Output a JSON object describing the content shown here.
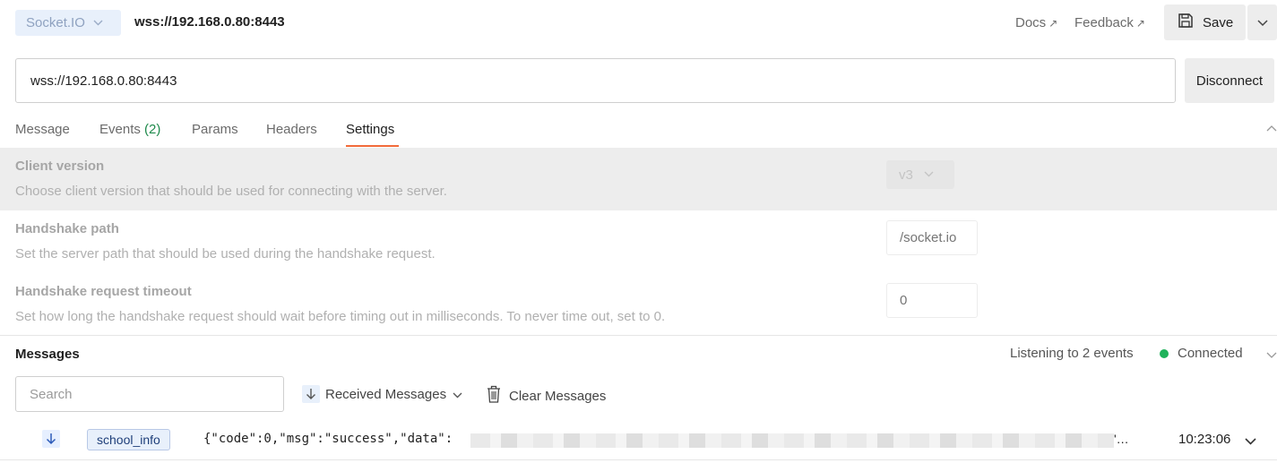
{
  "topbar": {
    "protocol": "Socket.IO",
    "url": "wss://192.168.0.80:8443",
    "docs_label": "Docs",
    "feedback_label": "Feedback",
    "save_label": "Save"
  },
  "connection": {
    "url_value": "wss://192.168.0.80:8443",
    "disconnect_label": "Disconnect"
  },
  "tabs": [
    {
      "label": "Message"
    },
    {
      "label": "Events",
      "count": "(2)"
    },
    {
      "label": "Params"
    },
    {
      "label": "Headers"
    },
    {
      "label": "Settings",
      "active": true
    }
  ],
  "settings": [
    {
      "title": "Client version",
      "description": "Choose client version that should be used for connecting with the server.",
      "value": "v3"
    },
    {
      "title": "Handshake path",
      "description": "Set the server path that should be used during the handshake request.",
      "placeholder": "/socket.io"
    },
    {
      "title": "Handshake request timeout",
      "description": "Set how long the handshake request should wait before timing out in milliseconds. To never time out, set to 0.",
      "placeholder": "0"
    }
  ],
  "messages": {
    "title": "Messages",
    "listening": "Listening to 2 events",
    "status": "Connected",
    "search_placeholder": "Search",
    "filter_label": "Received Messages",
    "clear_label": "Clear Messages",
    "rows": [
      {
        "event": "school_info",
        "payload": "{\"code\":0,\"msg\":\"success\",\"data\":",
        "ellipsis": "'…",
        "time": "10:23:06"
      }
    ]
  },
  "colors": {
    "accent_tab": "#f26b3a",
    "connected": "#1fb25a",
    "event_count": "#1f8a4c"
  }
}
